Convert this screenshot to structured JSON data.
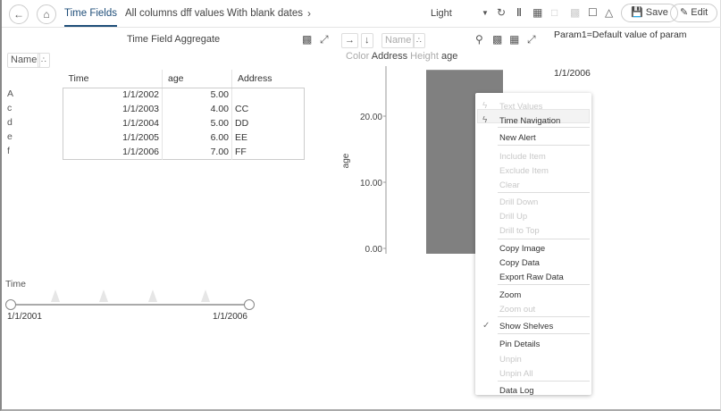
{
  "topbar": {
    "tabs": [
      "Time Fields",
      "All columns dff values",
      "With blank dates"
    ],
    "theme": "Light",
    "save": "Save",
    "edit": "Edit"
  },
  "table_panel": {
    "title": "Time Field Aggregate",
    "shelf": "Name",
    "columns": [
      "Time",
      "age",
      "Address"
    ],
    "rows": [
      {
        "label": "A",
        "time": "1/1/2002",
        "age": "5.00",
        "address": ""
      },
      {
        "label": "c",
        "time": "1/1/2003",
        "age": "4.00",
        "address": "CC"
      },
      {
        "label": "d",
        "time": "1/1/2004",
        "age": "5.00",
        "address": "DD"
      },
      {
        "label": "e",
        "time": "1/1/2005",
        "age": "6.00",
        "address": "EE"
      },
      {
        "label": "f",
        "time": "1/1/2006",
        "age": "7.00",
        "address": "FF"
      }
    ]
  },
  "chart_panel": {
    "shelf": "Name",
    "color_label": "Color",
    "color_value": "Address",
    "height_label": "Height",
    "height_value": "age",
    "param": "Param1=Default value of param",
    "date_label": "1/1/2006"
  },
  "chart_data": {
    "type": "bar",
    "categories": [
      ""
    ],
    "values": [
      27
    ],
    "ylabel": "age",
    "ylim": [
      0,
      28
    ],
    "yticks": [
      "0.00",
      "10.00",
      "20.00"
    ],
    "ytick_values": [
      0,
      10,
      20
    ],
    "bar_color": "#808080"
  },
  "slider": {
    "label": "Time",
    "start": "1/1/2001",
    "end": "1/1/2006"
  },
  "menu": {
    "items": [
      {
        "label": "Text Values",
        "disabled": true,
        "icon": "lightning"
      },
      {
        "label": "Time Navigation",
        "disabled": false,
        "icon": "lightning"
      },
      {
        "label": "New Alert",
        "disabled": false
      },
      {
        "label": "Include Item",
        "disabled": true
      },
      {
        "label": "Exclude Item",
        "disabled": true
      },
      {
        "label": "Clear",
        "disabled": true
      },
      {
        "label": "Drill Down",
        "disabled": true
      },
      {
        "label": "Drill Up",
        "disabled": true
      },
      {
        "label": "Drill to Top",
        "disabled": true
      },
      {
        "label": "Copy Image",
        "disabled": false
      },
      {
        "label": "Copy Data",
        "disabled": false
      },
      {
        "label": "Export Raw Data",
        "disabled": false
      },
      {
        "label": "Zoom",
        "disabled": false
      },
      {
        "label": "Zoom out",
        "disabled": true
      },
      {
        "label": "Show Shelves",
        "disabled": false,
        "checked": true
      },
      {
        "label": "Pin Details",
        "disabled": false
      },
      {
        "label": "Unpin",
        "disabled": true
      },
      {
        "label": "Unpin All",
        "disabled": true
      },
      {
        "label": "Data Log",
        "disabled": false
      }
    ]
  }
}
